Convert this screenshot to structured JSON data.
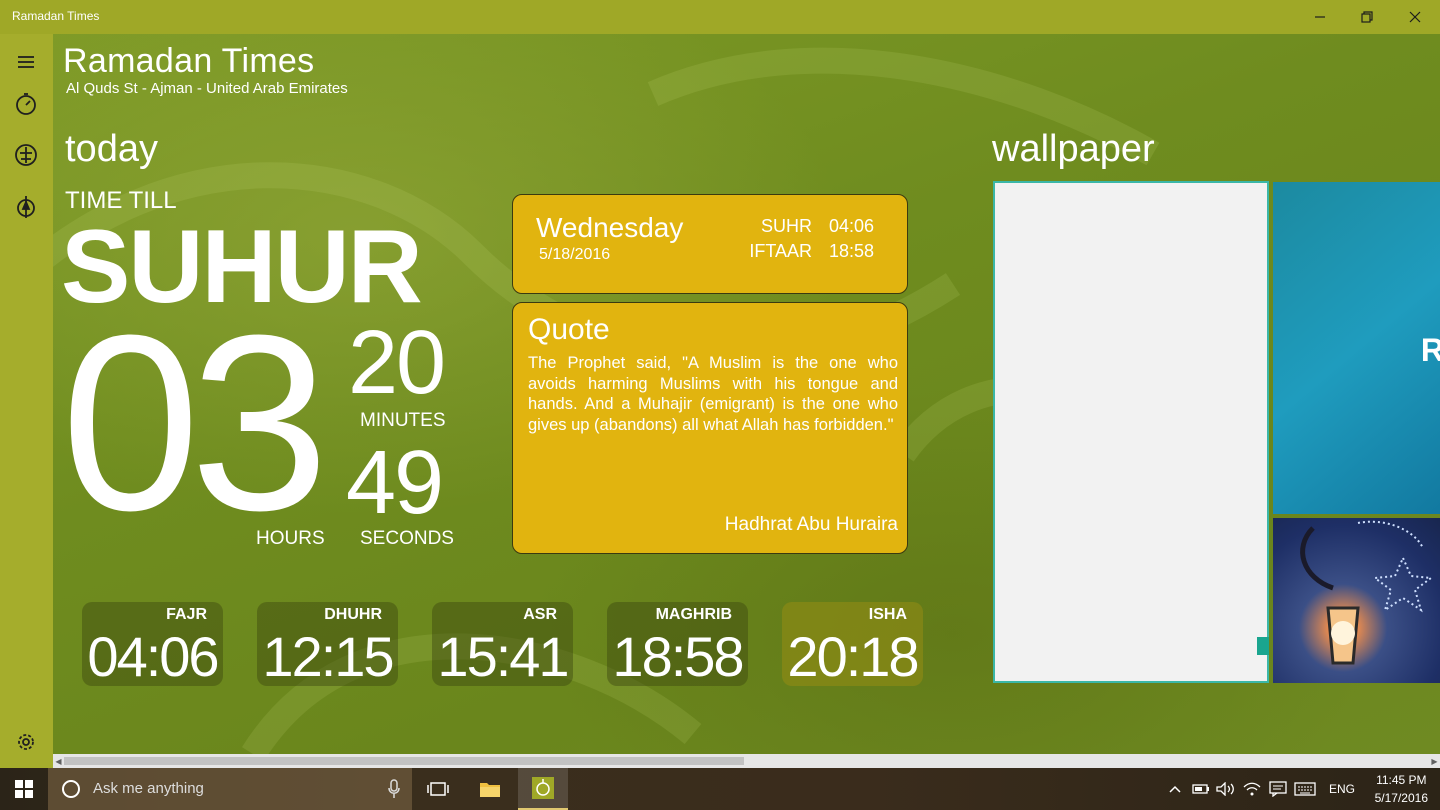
{
  "window": {
    "title": "Ramadan Times"
  },
  "header": {
    "title": "Ramadan Times",
    "location": "Al Quds St - Ajman - United Arab Emirates"
  },
  "today": {
    "heading": "today",
    "time_till_label": "TIME TILL",
    "event": "SUHUR",
    "hours": "03",
    "minutes": "20",
    "seconds": "49",
    "hours_label": "HOURS",
    "minutes_label": "MINUTES",
    "seconds_label": "SECONDS"
  },
  "day_card": {
    "day": "Wednesday",
    "date": "5/18/2016",
    "suhr_label": "SUHR",
    "suhr_time": "04:06",
    "iftaar_label": "IFTAAR",
    "iftaar_time": "18:58"
  },
  "quote": {
    "title": "Quote",
    "text": "The Prophet said, \"A Muslim is the one who avoids harming Muslims with his tongue and hands. And a Muhajir (emigrant) is the one who gives up (abandons) all what Allah has forbidden.\"",
    "author": "Hadhrat Abu Huraira"
  },
  "prayers": [
    {
      "name": "FAJR",
      "time": "04:06"
    },
    {
      "name": "DHUHR",
      "time": "12:15"
    },
    {
      "name": "ASR",
      "time": "15:41"
    },
    {
      "name": "MAGHRIB",
      "time": "18:58"
    },
    {
      "name": "ISHA",
      "time": "20:18"
    }
  ],
  "wallpaper": {
    "heading": "wallpaper",
    "blue_tile_letter": "R"
  },
  "taskbar": {
    "search_placeholder": "Ask me anything",
    "language": "ENG",
    "time": "11:45 PM",
    "date": "5/17/2016"
  }
}
